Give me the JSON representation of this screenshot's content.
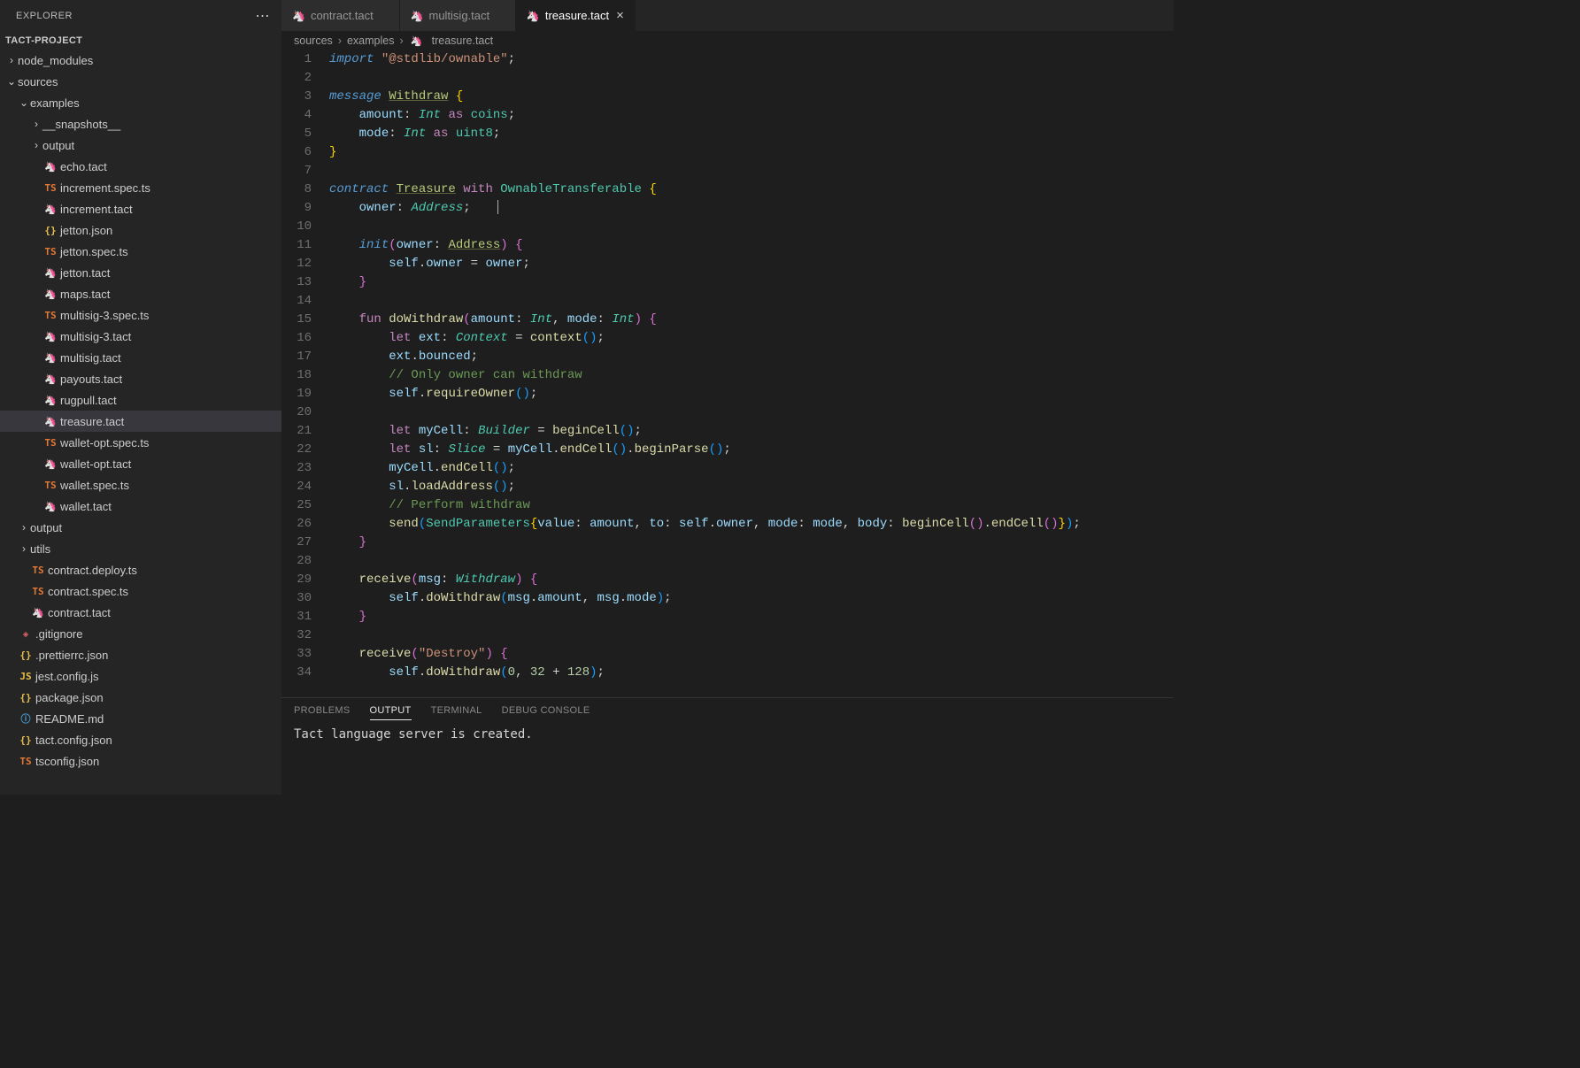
{
  "explorer": {
    "title": "EXPLORER",
    "project": "TACT-PROJECT",
    "tree": [
      {
        "t": "folder",
        "open": false,
        "d": 1,
        "label": "node_modules"
      },
      {
        "t": "folder",
        "open": true,
        "d": 1,
        "label": "sources"
      },
      {
        "t": "folder",
        "open": true,
        "d": 2,
        "label": "examples"
      },
      {
        "t": "folder",
        "open": false,
        "d": 3,
        "label": "__snapshots__"
      },
      {
        "t": "folder",
        "open": false,
        "d": 3,
        "label": "output"
      },
      {
        "t": "file",
        "ic": "tact",
        "d": 3,
        "label": "echo.tact"
      },
      {
        "t": "file",
        "ic": "ts",
        "d": 3,
        "label": "increment.spec.ts"
      },
      {
        "t": "file",
        "ic": "tact",
        "d": 3,
        "label": "increment.tact"
      },
      {
        "t": "file",
        "ic": "json",
        "d": 3,
        "label": "jetton.json"
      },
      {
        "t": "file",
        "ic": "ts",
        "d": 3,
        "label": "jetton.spec.ts"
      },
      {
        "t": "file",
        "ic": "tact",
        "d": 3,
        "label": "jetton.tact"
      },
      {
        "t": "file",
        "ic": "tact",
        "d": 3,
        "label": "maps.tact"
      },
      {
        "t": "file",
        "ic": "ts",
        "d": 3,
        "label": "multisig-3.spec.ts"
      },
      {
        "t": "file",
        "ic": "tact",
        "d": 3,
        "label": "multisig-3.tact"
      },
      {
        "t": "file",
        "ic": "tact",
        "d": 3,
        "label": "multisig.tact"
      },
      {
        "t": "file",
        "ic": "tact",
        "d": 3,
        "label": "payouts.tact"
      },
      {
        "t": "file",
        "ic": "tact",
        "d": 3,
        "label": "rugpull.tact"
      },
      {
        "t": "file",
        "ic": "tact",
        "d": 3,
        "label": "treasure.tact",
        "selected": true
      },
      {
        "t": "file",
        "ic": "ts",
        "d": 3,
        "label": "wallet-opt.spec.ts"
      },
      {
        "t": "file",
        "ic": "tact",
        "d": 3,
        "label": "wallet-opt.tact"
      },
      {
        "t": "file",
        "ic": "ts",
        "d": 3,
        "label": "wallet.spec.ts"
      },
      {
        "t": "file",
        "ic": "tact",
        "d": 3,
        "label": "wallet.tact"
      },
      {
        "t": "folder",
        "open": false,
        "d": 2,
        "label": "output"
      },
      {
        "t": "folder",
        "open": false,
        "d": 2,
        "label": "utils"
      },
      {
        "t": "file",
        "ic": "ts",
        "d": 2,
        "label": "contract.deploy.ts"
      },
      {
        "t": "file",
        "ic": "ts",
        "d": 2,
        "label": "contract.spec.ts"
      },
      {
        "t": "file",
        "ic": "tact",
        "d": 2,
        "label": "contract.tact"
      },
      {
        "t": "file",
        "ic": "git",
        "d": 1,
        "label": ".gitignore"
      },
      {
        "t": "file",
        "ic": "json",
        "d": 1,
        "label": ".prettierrc.json"
      },
      {
        "t": "file",
        "ic": "js",
        "d": 1,
        "label": "jest.config.js"
      },
      {
        "t": "file",
        "ic": "json",
        "d": 1,
        "label": "package.json"
      },
      {
        "t": "file",
        "ic": "info",
        "d": 1,
        "label": "README.md"
      },
      {
        "t": "file",
        "ic": "json",
        "d": 1,
        "label": "tact.config.json"
      },
      {
        "t": "file",
        "ic": "ts",
        "d": 1,
        "label": "tsconfig.json"
      }
    ]
  },
  "tabs": [
    {
      "label": "contract.tact",
      "ic": "tact",
      "active": false
    },
    {
      "label": "multisig.tact",
      "ic": "tact",
      "active": false
    },
    {
      "label": "treasure.tact",
      "ic": "tact",
      "active": true
    }
  ],
  "breadcrumbs": [
    "sources",
    "examples",
    "treasure.tact"
  ],
  "panel": {
    "tabs": [
      "PROBLEMS",
      "OUTPUT",
      "TERMINAL",
      "DEBUG CONSOLE"
    ],
    "active": "OUTPUT",
    "output": "Tact language server is created."
  },
  "code": {
    "lines": [
      [
        [
          "k-blue",
          "import"
        ],
        [
          "k-op",
          " "
        ],
        [
          "k-str",
          "\"@stdlib/ownable\""
        ],
        [
          "k-op",
          ";"
        ]
      ],
      [],
      [
        [
          "k-blue",
          "message"
        ],
        [
          "k-op",
          " "
        ],
        [
          "k-name",
          "Withdraw"
        ],
        [
          "k-op",
          " "
        ],
        [
          "k-br3",
          "{"
        ]
      ],
      [
        [
          "k-op",
          "    "
        ],
        [
          "k-prop",
          "amount"
        ],
        [
          "k-op",
          ": "
        ],
        [
          "k-type",
          "Int"
        ],
        [
          "k-op",
          " "
        ],
        [
          "k-mag",
          "as"
        ],
        [
          "k-op",
          " "
        ],
        [
          "k-class",
          "coins"
        ],
        [
          "k-op",
          ";"
        ]
      ],
      [
        [
          "k-op",
          "    "
        ],
        [
          "k-prop",
          "mode"
        ],
        [
          "k-op",
          ": "
        ],
        [
          "k-type",
          "Int"
        ],
        [
          "k-op",
          " "
        ],
        [
          "k-mag",
          "as"
        ],
        [
          "k-op",
          " "
        ],
        [
          "k-class",
          "uint8"
        ],
        [
          "k-op",
          ";"
        ]
      ],
      [
        [
          "k-br3",
          "}"
        ]
      ],
      [],
      [
        [
          "k-blue",
          "contract"
        ],
        [
          "k-op",
          " "
        ],
        [
          "k-name",
          "Treasure"
        ],
        [
          "k-op",
          " "
        ],
        [
          "k-mag",
          "with"
        ],
        [
          "k-op",
          " "
        ],
        [
          "k-class",
          "OwnableTransferable"
        ],
        [
          "k-op",
          " "
        ],
        [
          "k-br3",
          "{"
        ]
      ],
      [
        [
          "k-op",
          "    "
        ],
        [
          "k-prop",
          "owner"
        ],
        [
          "k-op",
          ": "
        ],
        [
          "k-type",
          "Address"
        ],
        [
          "k-op",
          ";"
        ],
        [
          "cursor",
          ""
        ]
      ],
      [],
      [
        [
          "k-op",
          "    "
        ],
        [
          "k-blue",
          "init"
        ],
        [
          "k-br",
          "("
        ],
        [
          "k-prop",
          "owner"
        ],
        [
          "k-op",
          ": "
        ],
        [
          "k-name",
          "Address"
        ],
        [
          "k-br",
          ")"
        ],
        [
          "k-op",
          " "
        ],
        [
          "k-br",
          "{"
        ]
      ],
      [
        [
          "k-op",
          "        "
        ],
        [
          "k-prop",
          "self"
        ],
        [
          "k-op",
          "."
        ],
        [
          "k-prop",
          "owner"
        ],
        [
          "k-op",
          " = "
        ],
        [
          "k-prop",
          "owner"
        ],
        [
          "k-op",
          ";"
        ]
      ],
      [
        [
          "k-op",
          "    "
        ],
        [
          "k-br",
          "}"
        ]
      ],
      [],
      [
        [
          "k-op",
          "    "
        ],
        [
          "k-mag",
          "fun"
        ],
        [
          "k-op",
          " "
        ],
        [
          "k-fn",
          "doWithdraw"
        ],
        [
          "k-br",
          "("
        ],
        [
          "k-prop",
          "amount"
        ],
        [
          "k-op",
          ": "
        ],
        [
          "k-type",
          "Int"
        ],
        [
          "k-op",
          ", "
        ],
        [
          "k-prop",
          "mode"
        ],
        [
          "k-op",
          ": "
        ],
        [
          "k-type",
          "Int"
        ],
        [
          "k-br",
          ")"
        ],
        [
          "k-op",
          " "
        ],
        [
          "k-br",
          "{"
        ]
      ],
      [
        [
          "k-op",
          "        "
        ],
        [
          "k-mag",
          "let"
        ],
        [
          "k-op",
          " "
        ],
        [
          "k-prop",
          "ext"
        ],
        [
          "k-op",
          ": "
        ],
        [
          "k-type",
          "Context"
        ],
        [
          "k-op",
          " = "
        ],
        [
          "k-fn",
          "context"
        ],
        [
          "k-br2",
          "("
        ],
        [
          "k-br2",
          ")"
        ],
        [
          "k-op",
          ";"
        ]
      ],
      [
        [
          "k-op",
          "        "
        ],
        [
          "k-prop",
          "ext"
        ],
        [
          "k-op",
          "."
        ],
        [
          "k-prop",
          "bounced"
        ],
        [
          "k-op",
          ";"
        ]
      ],
      [
        [
          "k-op",
          "        "
        ],
        [
          "k-comm",
          "// Only owner can withdraw"
        ]
      ],
      [
        [
          "k-op",
          "        "
        ],
        [
          "k-prop",
          "self"
        ],
        [
          "k-op",
          "."
        ],
        [
          "k-fn",
          "requireOwner"
        ],
        [
          "k-br2",
          "("
        ],
        [
          "k-br2",
          ")"
        ],
        [
          "k-op",
          ";"
        ]
      ],
      [],
      [
        [
          "k-op",
          "        "
        ],
        [
          "k-mag",
          "let"
        ],
        [
          "k-op",
          " "
        ],
        [
          "k-prop",
          "myCell"
        ],
        [
          "k-op",
          ": "
        ],
        [
          "k-type",
          "Builder"
        ],
        [
          "k-op",
          " = "
        ],
        [
          "k-fn",
          "beginCell"
        ],
        [
          "k-br2",
          "("
        ],
        [
          "k-br2",
          ")"
        ],
        [
          "k-op",
          ";"
        ]
      ],
      [
        [
          "k-op",
          "        "
        ],
        [
          "k-mag",
          "let"
        ],
        [
          "k-op",
          " "
        ],
        [
          "k-prop",
          "sl"
        ],
        [
          "k-op",
          ": "
        ],
        [
          "k-type",
          "Slice"
        ],
        [
          "k-op",
          " = "
        ],
        [
          "k-prop",
          "myCell"
        ],
        [
          "k-op",
          "."
        ],
        [
          "k-fn",
          "endCell"
        ],
        [
          "k-br2",
          "("
        ],
        [
          "k-br2",
          ")"
        ],
        [
          "k-op",
          "."
        ],
        [
          "k-fn",
          "beginParse"
        ],
        [
          "k-br2",
          "("
        ],
        [
          "k-br2",
          ")"
        ],
        [
          "k-op",
          ";"
        ]
      ],
      [
        [
          "k-op",
          "        "
        ],
        [
          "k-prop",
          "myCell"
        ],
        [
          "k-op",
          "."
        ],
        [
          "k-fn",
          "endCell"
        ],
        [
          "k-br2",
          "("
        ],
        [
          "k-br2",
          ")"
        ],
        [
          "k-op",
          ";"
        ]
      ],
      [
        [
          "k-op",
          "        "
        ],
        [
          "k-prop",
          "sl"
        ],
        [
          "k-op",
          "."
        ],
        [
          "k-fn",
          "loadAddress"
        ],
        [
          "k-br2",
          "("
        ],
        [
          "k-br2",
          ")"
        ],
        [
          "k-op",
          ";"
        ]
      ],
      [
        [
          "k-op",
          "        "
        ],
        [
          "k-comm",
          "// Perform withdraw"
        ]
      ],
      [
        [
          "k-op",
          "        "
        ],
        [
          "k-fn",
          "send"
        ],
        [
          "k-br2",
          "("
        ],
        [
          "k-class",
          "SendParameters"
        ],
        [
          "k-br3",
          "{"
        ],
        [
          "k-prop",
          "value"
        ],
        [
          "k-op",
          ": "
        ],
        [
          "k-prop",
          "amount"
        ],
        [
          "k-op",
          ", "
        ],
        [
          "k-prop",
          "to"
        ],
        [
          "k-op",
          ": "
        ],
        [
          "k-prop",
          "self"
        ],
        [
          "k-op",
          "."
        ],
        [
          "k-prop",
          "owner"
        ],
        [
          "k-op",
          ", "
        ],
        [
          "k-prop",
          "mode"
        ],
        [
          "k-op",
          ": "
        ],
        [
          "k-prop",
          "mode"
        ],
        [
          "k-op",
          ", "
        ],
        [
          "k-prop",
          "body"
        ],
        [
          "k-op",
          ": "
        ],
        [
          "k-fn",
          "beginCell"
        ],
        [
          "k-br",
          "("
        ],
        [
          "k-br",
          ")"
        ],
        [
          "k-op",
          "."
        ],
        [
          "k-fn",
          "endCell"
        ],
        [
          "k-br",
          "("
        ],
        [
          "k-br",
          ")"
        ],
        [
          "k-br3",
          "}"
        ],
        [
          "k-br2",
          ")"
        ],
        [
          "k-op",
          ";"
        ]
      ],
      [
        [
          "k-op",
          "    "
        ],
        [
          "k-br",
          "}"
        ]
      ],
      [],
      [
        [
          "k-op",
          "    "
        ],
        [
          "k-fn",
          "receive"
        ],
        [
          "k-br",
          "("
        ],
        [
          "k-prop",
          "msg"
        ],
        [
          "k-op",
          ": "
        ],
        [
          "k-type",
          "Withdraw"
        ],
        [
          "k-br",
          ")"
        ],
        [
          "k-op",
          " "
        ],
        [
          "k-br",
          "{"
        ]
      ],
      [
        [
          "k-op",
          "        "
        ],
        [
          "k-prop",
          "self"
        ],
        [
          "k-op",
          "."
        ],
        [
          "k-fn",
          "doWithdraw"
        ],
        [
          "k-br2",
          "("
        ],
        [
          "k-prop",
          "msg"
        ],
        [
          "k-op",
          "."
        ],
        [
          "k-prop",
          "amount"
        ],
        [
          "k-op",
          ", "
        ],
        [
          "k-prop",
          "msg"
        ],
        [
          "k-op",
          "."
        ],
        [
          "k-prop",
          "mode"
        ],
        [
          "k-br2",
          ")"
        ],
        [
          "k-op",
          ";"
        ]
      ],
      [
        [
          "k-op",
          "    "
        ],
        [
          "k-br",
          "}"
        ]
      ],
      [],
      [
        [
          "k-op",
          "    "
        ],
        [
          "k-fn",
          "receive"
        ],
        [
          "k-br",
          "("
        ],
        [
          "k-str",
          "\"Destroy\""
        ],
        [
          "k-br",
          ")"
        ],
        [
          "k-op",
          " "
        ],
        [
          "k-br",
          "{"
        ]
      ],
      [
        [
          "k-op",
          "        "
        ],
        [
          "k-prop",
          "self"
        ],
        [
          "k-op",
          "."
        ],
        [
          "k-fn",
          "doWithdraw"
        ],
        [
          "k-br2",
          "("
        ],
        [
          "k-num",
          "0"
        ],
        [
          "k-op",
          ", "
        ],
        [
          "k-num",
          "32"
        ],
        [
          "k-op",
          " + "
        ],
        [
          "k-num",
          "128"
        ],
        [
          "k-br2",
          ")"
        ],
        [
          "k-op",
          ";"
        ]
      ]
    ]
  }
}
